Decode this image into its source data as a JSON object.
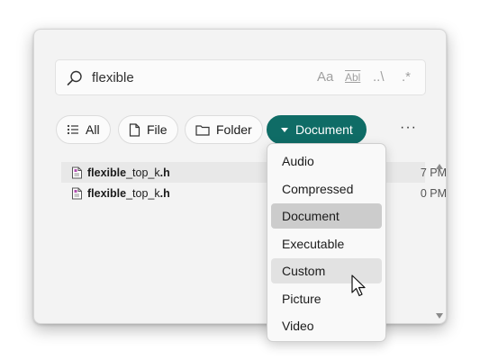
{
  "search": {
    "query": "flexible",
    "options": [
      "Aa",
      "Abl",
      "..\\",
      ".*"
    ]
  },
  "filters": [
    {
      "label": "All",
      "icon": "list-icon"
    },
    {
      "label": "File",
      "icon": "file-icon"
    },
    {
      "label": "Folder",
      "icon": "folder-icon"
    },
    {
      "label": "Document",
      "icon": "caret-down-icon",
      "active": true
    }
  ],
  "more_label": "···",
  "results": [
    {
      "match": "flexible",
      "rest": "_top_k",
      "ext": ".h",
      "time": "7 PM"
    },
    {
      "match": "flexible",
      "rest": "_top_k",
      "ext": ".h",
      "time": "0 PM"
    }
  ],
  "menu": {
    "items": [
      "Audio",
      "Compressed",
      "Document",
      "Executable",
      "Custom",
      "Picture",
      "Video"
    ],
    "checked": "Document",
    "hovered": "Custom"
  },
  "colors": {
    "accent": "#0f6c66",
    "selected": "#cccccc",
    "hover": "#e2e2e2"
  }
}
